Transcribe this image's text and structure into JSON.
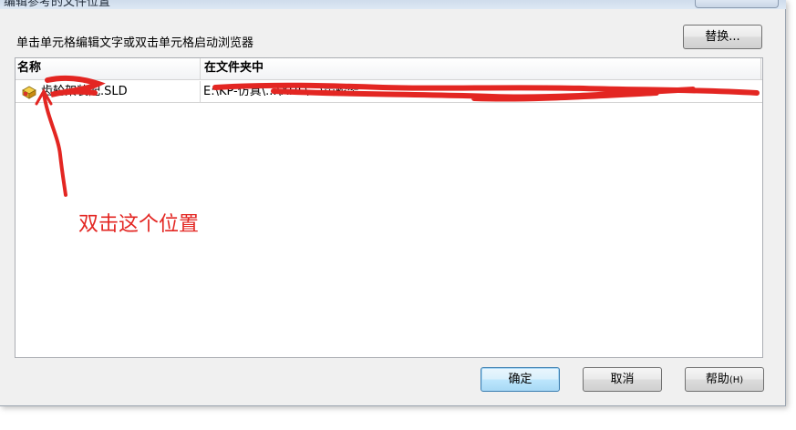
{
  "window": {
    "title": "编辑参考的文件位置"
  },
  "instructions": "单击单元格编辑文字或双击单元格启动浏览器",
  "buttons": {
    "replace": "替换...",
    "ok": "确定",
    "cancel": "取消",
    "help": "帮助",
    "help_accel": "(H)"
  },
  "table": {
    "columns": [
      "名称",
      "在文件夹中"
    ],
    "rows": [
      {
        "name": "齿轮架装配.SLD",
        "folder": "E:\\KP-仿真\\...\\XHL\\...\\齿轮架"
      }
    ]
  },
  "annotation": {
    "text": "双击这个位置",
    "color": "#e32622"
  },
  "colors": {
    "dialog_bg": "#f0f0f0",
    "default_button_border": "#3c7fb1",
    "list_border": "#abadb3"
  },
  "icons": {
    "file": "assembly-file-icon",
    "arrow": "red-hand-drawn-arrow"
  }
}
